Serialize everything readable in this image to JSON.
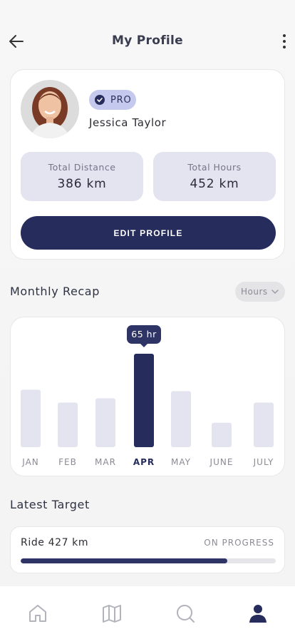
{
  "header": {
    "title": "My Profile"
  },
  "profile": {
    "badge": "PRO",
    "name": "Jessica Taylor",
    "stats": [
      {
        "label": "Total Distance",
        "value": "386 km"
      },
      {
        "label": "Total Hours",
        "value": "452 km"
      }
    ],
    "edit_label": "EDIT PROFILE"
  },
  "recap": {
    "title": "Monthly Recap",
    "filter": "Hours"
  },
  "chart_data": {
    "type": "bar",
    "categories": [
      "JAN",
      "FEB",
      "MAR",
      "APR",
      "MAY",
      "JUNE",
      "JULY"
    ],
    "values": [
      40,
      31,
      34,
      65,
      39,
      17,
      31
    ],
    "highlighted_index": 3,
    "tooltip": "65 hr",
    "ylim": [
      0,
      65
    ],
    "colors": {
      "bar": "#e3e4ef",
      "highlight": "#262c5b",
      "label": "#8a8b94",
      "label_active": "#262c5b"
    }
  },
  "target": {
    "title": "Latest Target",
    "label": "Ride 427 km",
    "status": "ON PROGRESS",
    "progress": 0.81
  },
  "nav": {
    "items": [
      {
        "icon": "home-icon",
        "active": false
      },
      {
        "icon": "map-icon",
        "active": false
      },
      {
        "icon": "search-icon",
        "active": false
      },
      {
        "icon": "profile-icon",
        "active": true
      }
    ]
  }
}
